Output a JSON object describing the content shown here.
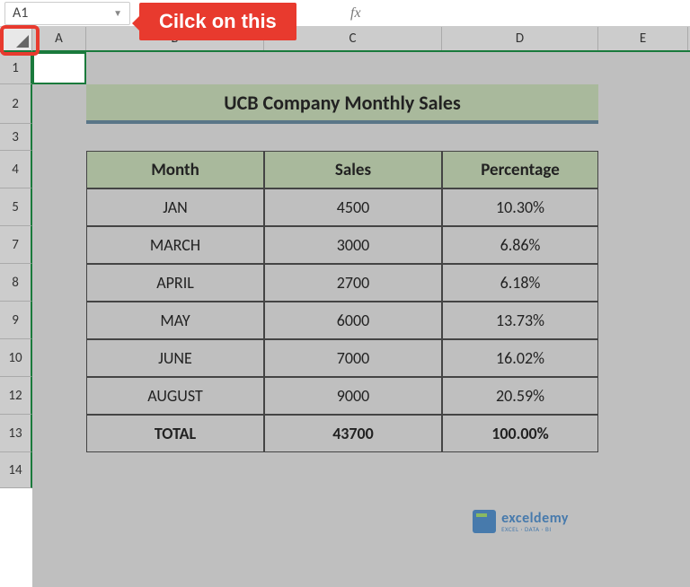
{
  "namebox": {
    "value": "A1"
  },
  "callout": {
    "text": "Cilck on this"
  },
  "columns": {
    "A": "A",
    "B": "B",
    "C": "C",
    "D": "D",
    "E": "E"
  },
  "row_numbers": [
    "1",
    "2",
    "3",
    "4",
    "5",
    "7",
    "8",
    "9",
    "10",
    "12",
    "13",
    "14"
  ],
  "title": "UCB Company Monthly Sales",
  "headers": {
    "month": "Month",
    "sales": "Sales",
    "percentage": "Percentage"
  },
  "rows": [
    {
      "month": "JAN",
      "sales": "4500",
      "percentage": "10.30%"
    },
    {
      "month": "MARCH",
      "sales": "3000",
      "percentage": "6.86%"
    },
    {
      "month": "APRIL",
      "sales": "2700",
      "percentage": "6.18%"
    },
    {
      "month": "MAY",
      "sales": "6000",
      "percentage": "13.73%"
    },
    {
      "month": "JUNE",
      "sales": "7000",
      "percentage": "16.02%"
    },
    {
      "month": "AUGUST",
      "sales": "9000",
      "percentage": "20.59%"
    }
  ],
  "total": {
    "label": "TOTAL",
    "sales": "43700",
    "percentage": "100.00%"
  },
  "watermark": {
    "main": "exceldemy",
    "sub": "EXCEL · DATA · BI"
  }
}
